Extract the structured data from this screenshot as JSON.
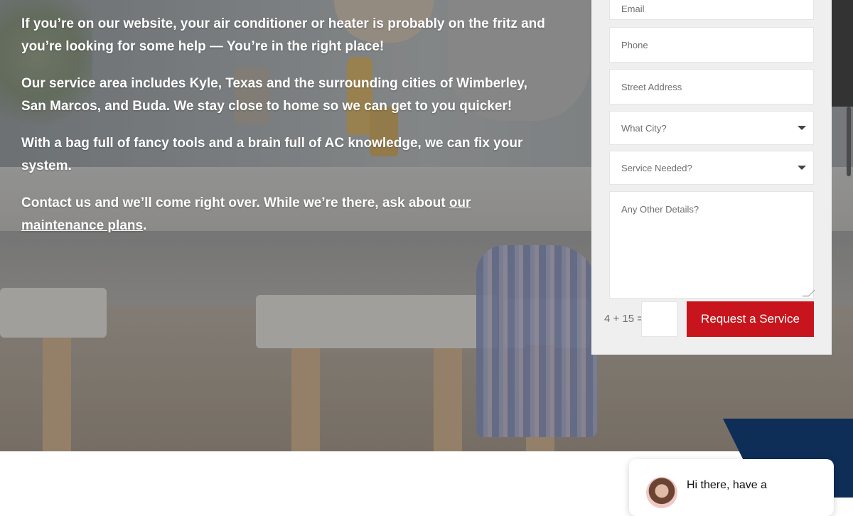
{
  "intro": {
    "p1": "If you’re on our website, your air conditioner or heater is probably on the fritz and you’re looking for some help — You’re in the right place!",
    "p2": "Our service area includes Kyle, Texas and the surrounding cities of Wimberley, San Marcos, and Buda. We stay close to home so we can get to you quicker!",
    "p3": "With a bag full of fancy tools and a brain full of AC knowledge, we can fix your system.",
    "p4_before": "Contact us and we’ll come right over.  While we’re there, ask about ",
    "p4_link": "our maintenance plans",
    "p4_after": "."
  },
  "form": {
    "email_placeholder": "Email",
    "phone_placeholder": "Phone",
    "address_placeholder": "Street Address",
    "city_select": "What City?",
    "service_select": "Service Needed?",
    "details_placeholder": "Any Other Details?",
    "captcha_question": "4 + 15 =",
    "submit_label": "Request a Service"
  },
  "chat": {
    "greeting": "Hi there, have a"
  },
  "colors": {
    "submit": "#c8141c",
    "navy": "#0e2d57"
  }
}
